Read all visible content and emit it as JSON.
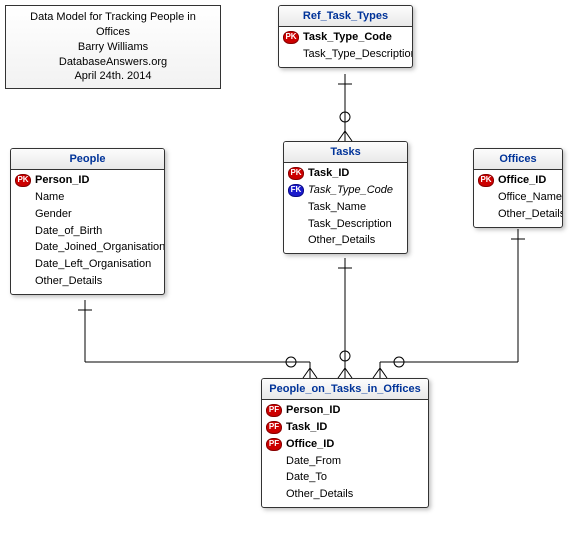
{
  "info": {
    "line1": "Data Model for Tracking People in Offices",
    "line2": "Barry Williams",
    "line3": "DatabaseAnswers.org",
    "line4": "April 24th. 2014"
  },
  "entities": {
    "ref_task_types": {
      "title": "Ref_Task_Types",
      "attrs": [
        {
          "icon": "PK",
          "name": "Task_Type_Code",
          "key": true
        },
        {
          "icon": "",
          "name": "Task_Type_Description"
        }
      ]
    },
    "people": {
      "title": "People",
      "attrs": [
        {
          "icon": "PK",
          "name": "Person_ID",
          "key": true
        },
        {
          "icon": "",
          "name": "Name"
        },
        {
          "icon": "",
          "name": "Gender"
        },
        {
          "icon": "",
          "name": "Date_of_Birth"
        },
        {
          "icon": "",
          "name": "Date_Joined_Organisation"
        },
        {
          "icon": "",
          "name": "Date_Left_Organisation"
        },
        {
          "icon": "",
          "name": "Other_Details"
        }
      ]
    },
    "tasks": {
      "title": "Tasks",
      "attrs": [
        {
          "icon": "PK",
          "name": "Task_ID",
          "key": true
        },
        {
          "icon": "FK",
          "name": "Task_Type_Code",
          "fk": true
        },
        {
          "icon": "",
          "name": "Task_Name"
        },
        {
          "icon": "",
          "name": "Task_Description"
        },
        {
          "icon": "",
          "name": "Other_Details"
        }
      ]
    },
    "offices": {
      "title": "Offices",
      "attrs": [
        {
          "icon": "PK",
          "name": "Office_ID",
          "key": true
        },
        {
          "icon": "",
          "name": "Office_Name"
        },
        {
          "icon": "",
          "name": "Other_Details"
        }
      ]
    },
    "potio": {
      "title": "People_on_Tasks_in_Offices",
      "attrs": [
        {
          "icon": "PF",
          "name": "Person_ID",
          "key": true
        },
        {
          "icon": "PF",
          "name": "Task_ID",
          "key": true
        },
        {
          "icon": "PF",
          "name": "Office_ID",
          "key": true
        },
        {
          "icon": "",
          "name": "Date_From"
        },
        {
          "icon": "",
          "name": "Date_To"
        },
        {
          "icon": "",
          "name": "Other_Details"
        }
      ]
    }
  },
  "icon_labels": {
    "PK": "PK",
    "FK": "FK",
    "PF": "PF"
  }
}
